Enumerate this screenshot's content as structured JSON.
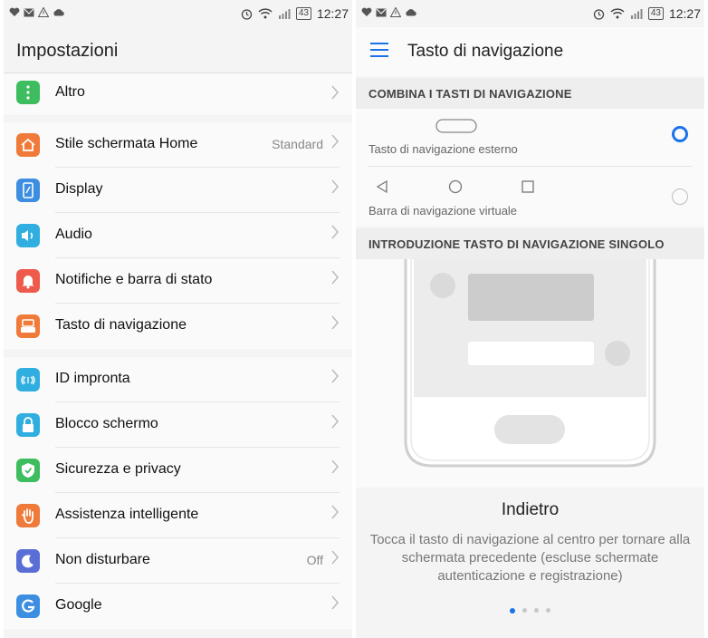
{
  "status_bar": {
    "time": "12:27",
    "battery": "43"
  },
  "left": {
    "title": "Impostazioni",
    "groups": [
      {
        "items": [
          {
            "label": "Altro",
            "icon": "more-dots-icon",
            "color": "#3dbd5e"
          }
        ]
      },
      {
        "items": [
          {
            "label": "Stile schermata Home",
            "value": "Standard",
            "icon": "home-icon",
            "color": "#ef7a3a"
          },
          {
            "label": "Display",
            "icon": "phone-screen-icon",
            "color": "#3d8ee0"
          },
          {
            "label": "Audio",
            "icon": "speaker-icon",
            "color": "#31aee0"
          },
          {
            "label": "Notifiche e barra di stato",
            "icon": "bell-icon",
            "color": "#ee5a4b"
          },
          {
            "label": "Tasto di navigazione",
            "icon": "keyboard-icon",
            "color": "#ef7a3a"
          }
        ]
      },
      {
        "items": [
          {
            "label": "ID impronta",
            "icon": "fingerprint-icon",
            "color": "#31aee0"
          },
          {
            "label": "Blocco schermo",
            "icon": "lock-icon",
            "color": "#31aee0"
          },
          {
            "label": "Sicurezza e privacy",
            "icon": "shield-icon",
            "color": "#3dbd5e"
          },
          {
            "label": "Assistenza intelligente",
            "icon": "hand-icon",
            "color": "#ef7a3a"
          },
          {
            "label": "Non disturbare",
            "value": "Off",
            "icon": "moon-icon",
            "color": "#5a6fd6"
          },
          {
            "label": "Google",
            "icon": "google-icon",
            "color": "#3d8ee0"
          }
        ]
      }
    ]
  },
  "right": {
    "title": "Tasto di navigazione",
    "section1": "COMBINA I TASTI DI NAVIGAZIONE",
    "option_external": "Tasto di navigazione esterno",
    "option_virtual": "Barra di navigazione virtuale",
    "section2": "INTRODUZIONE TASTO DI NAVIGAZIONE SINGOLO",
    "desc_title": "Indietro",
    "desc_text": "Tocca il tasto di navigazione al centro per tornare alla schermata precedente (escluse schermate autenticazione e registrazione)",
    "accent": "#1a73e8"
  }
}
